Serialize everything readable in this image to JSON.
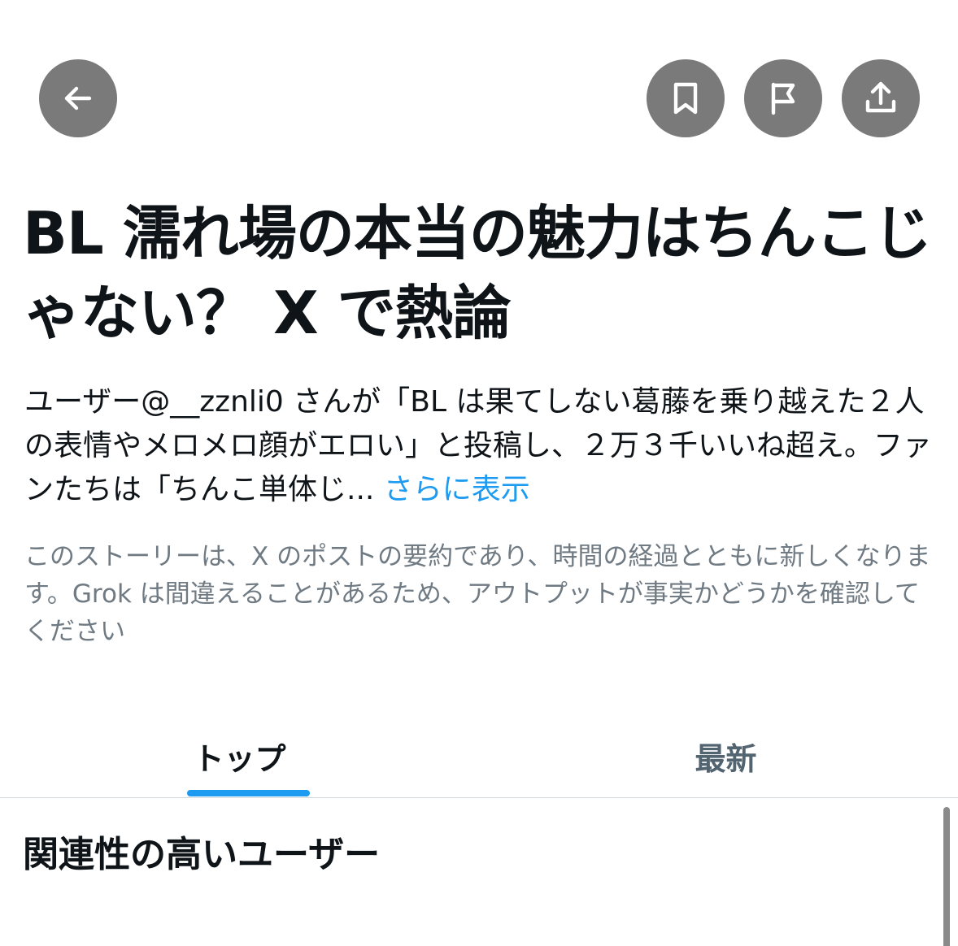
{
  "toolbar": {
    "back_icon": "arrow-left-icon",
    "bookmark_icon": "bookmark-icon",
    "report_icon": "flag-icon",
    "share_icon": "share-icon",
    "button_color": "#7a7a7a"
  },
  "story": {
    "title": "BL 濡れ場の本当の魅力はちんこじゃない？ X で熱論",
    "summary": "ユーザー@__zznli0 さんが「BL は果てしない葛藤を乗り越えた２人の表情やメロメロ顔がエロい」と投稿し、２万３千いいね超え。ファンたちは「ちんこ単体じ... ",
    "show_more": "さらに表示",
    "disclaimer": "このストーリーは、X のポストの要約であり、時間の経過とともに新しくなります。Grok は間違えることがあるため、アウトプットが事実かどうかを確認してください"
  },
  "tabs": [
    {
      "label": "トップ",
      "active": true
    },
    {
      "label": "最新",
      "active": false
    }
  ],
  "section": {
    "title": "関連性の高いユーザー"
  },
  "colors": {
    "accent": "#1d9bf0",
    "text": "#0f1419",
    "muted": "#6f7a83"
  }
}
